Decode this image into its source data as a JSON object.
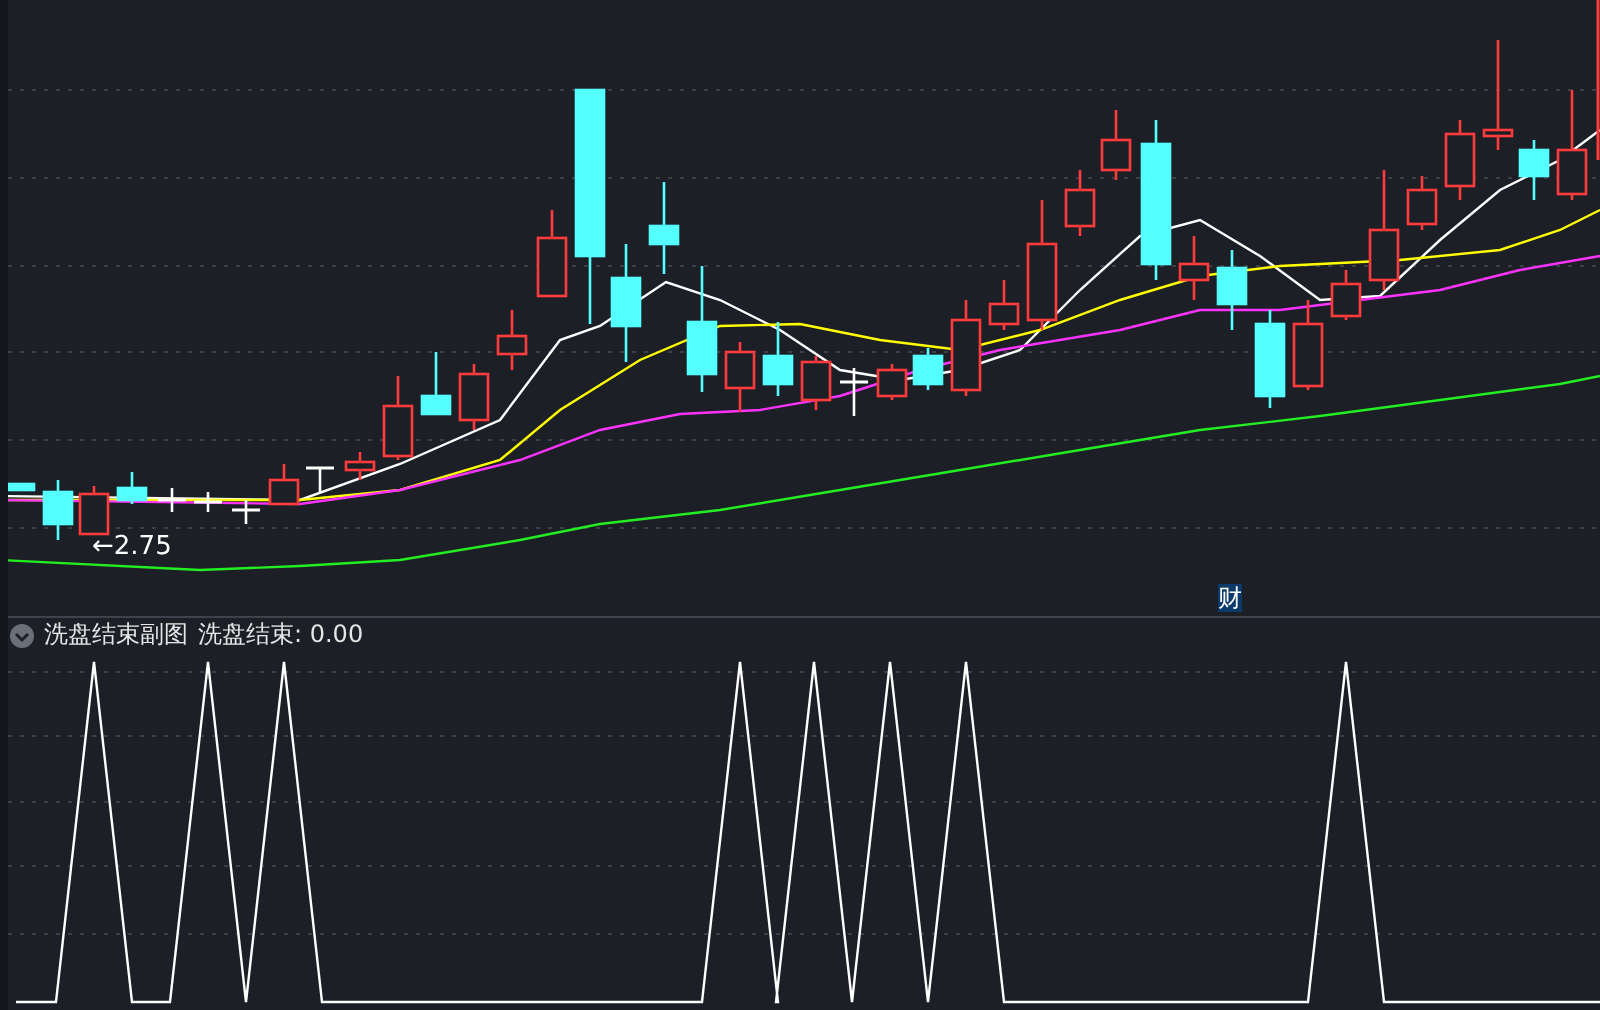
{
  "main_chart": {
    "price_label": "←2.75",
    "marker": "财"
  },
  "sub_chart": {
    "title": "洗盘结束副图",
    "readout": "洗盘结束: 0.00"
  }
}
